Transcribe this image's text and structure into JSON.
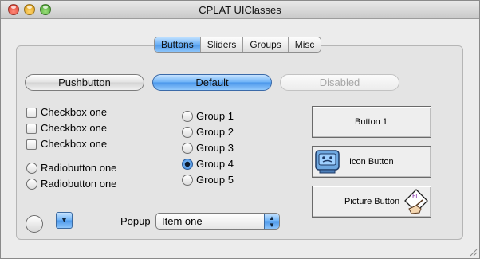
{
  "window": {
    "title": "CPLAT UIClasses"
  },
  "tabs": [
    {
      "label": "Buttons",
      "active": true
    },
    {
      "label": "Sliders",
      "active": false
    },
    {
      "label": "Groups",
      "active": false
    },
    {
      "label": "Misc",
      "active": false
    }
  ],
  "push_buttons": {
    "pushbutton": "Pushbutton",
    "default": "Default",
    "disabled": "Disabled"
  },
  "checkboxes": [
    {
      "label": "Checkbox one",
      "checked": false
    },
    {
      "label": "Checkbox one",
      "checked": false
    },
    {
      "label": "Checkbox one",
      "checked": false
    }
  ],
  "radiobuttons": [
    {
      "label": "Radiobutton one",
      "selected": false
    },
    {
      "label": "Radiobutton one",
      "selected": false
    }
  ],
  "group": {
    "items": [
      "Group 1",
      "Group 2",
      "Group 3",
      "Group 4",
      "Group 5"
    ],
    "selected": "Group 4"
  },
  "bevel_buttons": {
    "button1": "Button 1",
    "icon_button": "Icon Button",
    "picture_button": "Picture Button"
  },
  "popup": {
    "label": "Popup",
    "value": "Item one"
  },
  "icons": {
    "disclosure": "chevron-down-icon",
    "popup_arrows": "up-down-arrows-icon",
    "icon_button": "computer-face-icon",
    "picture_button": "hand-pointing-card-icon",
    "resize": "resize-grip-icon"
  },
  "colors": {
    "accent": "#4d98ea",
    "window": "#ececec"
  }
}
